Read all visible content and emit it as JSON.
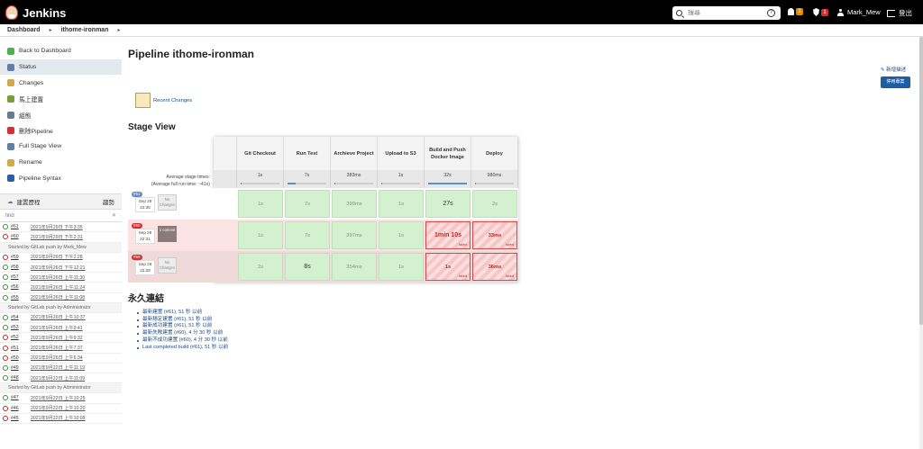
{
  "header": {
    "logo_text": "Jenkins",
    "search_placeholder": "搜尋",
    "notifications_count": "1",
    "security_count": "1",
    "user": "Mark_Mew",
    "logout": "登出"
  },
  "breadcrumb": [
    "Dashboard",
    "ithome-ironman"
  ],
  "sidebar": {
    "tasks": [
      {
        "label": "Back to Dashboard",
        "icon": "up-arrow-icon",
        "color": "#4caf50"
      },
      {
        "label": "Status",
        "icon": "search-icon",
        "color": "#5f7fa3",
        "active": true
      },
      {
        "label": "Changes",
        "icon": "notepad-icon",
        "color": "#d4a84f"
      },
      {
        "label": "馬上建置",
        "icon": "clock-icon",
        "color": "#7c9c3b"
      },
      {
        "label": "組態",
        "icon": "gear-icon",
        "color": "#6b7a8f"
      },
      {
        "label": "刪除Pipeline",
        "icon": "no-entry-icon",
        "color": "#d32f2f"
      },
      {
        "label": "Full Stage View",
        "icon": "magnifier-icon",
        "color": "#5f7fa3"
      },
      {
        "label": "Rename",
        "icon": "notepad-icon",
        "color": "#d4a84f"
      },
      {
        "label": "Pipeline Syntax",
        "icon": "help-icon",
        "color": "#2c5ea8"
      }
    ],
    "build_history": {
      "title": "建置歷程",
      "trend": "趨勢",
      "filter_placeholder": "find",
      "builds": [
        {
          "status": "ok",
          "num": "#61",
          "date": "2021年9月29日 下午3:35"
        },
        {
          "status": "fail",
          "num": "#60",
          "date": "2021年9月29日 下午2:31"
        },
        {
          "note": "Started by GitLab push by Mark_Mew"
        },
        {
          "status": "fail",
          "num": "#59",
          "date": "2021年9月29日 下午2:28"
        },
        {
          "status": "ok",
          "num": "#58",
          "date": "2021年9月26日 下午12:21"
        },
        {
          "status": "ok",
          "num": "#57",
          "date": "2021年9月26日 上午11:30"
        },
        {
          "status": "ok",
          "num": "#56",
          "date": "2021年9月26日 上午11:24"
        },
        {
          "status": "ok",
          "num": "#55",
          "date": "2021年9月26日 上午11:08"
        },
        {
          "note": "Started by GitLab push by Administrator"
        },
        {
          "status": "ok",
          "num": "#54",
          "date": "2021年9月26日 上午10:37"
        },
        {
          "status": "ok",
          "num": "#53",
          "date": "2021年9月26日 上午9:41"
        },
        {
          "status": "fail",
          "num": "#52",
          "date": "2021年9月26日 上午9:32"
        },
        {
          "status": "fail",
          "num": "#51",
          "date": "2021年9月26日 上午7:37"
        },
        {
          "status": "fail",
          "num": "#50",
          "date": "2021年9月26日 上午6:34"
        },
        {
          "status": "ok",
          "num": "#49",
          "date": "2021年9月22日 上午11:19"
        },
        {
          "status": "ok",
          "num": "#48",
          "date": "2021年9月22日 上午11:09"
        },
        {
          "note": "Started by GitLab push by Administrator"
        },
        {
          "status": "ok",
          "num": "#47",
          "date": "2021年9月22日 上午10:25"
        },
        {
          "status": "fail",
          "num": "#46",
          "date": "2021年9月22日 上午10:20"
        },
        {
          "status": "fail",
          "num": "#45",
          "date": "2021年9月22日 上午10:09"
        }
      ]
    }
  },
  "main": {
    "title": "Pipeline ithome-ironman",
    "edit_description": "新增描述",
    "disable_button": "停用專案",
    "recent_changes": "Recent Changes",
    "stage_view_title": "Stage View",
    "avg_label_1": "Average stage times:",
    "avg_label_2": "(Average full run time: ~41s)",
    "stages": [
      {
        "name": "Git Checkout",
        "avg": "1s",
        "fill": 0.03
      },
      {
        "name": "Run Test",
        "avg": "7s",
        "fill": 0.22
      },
      {
        "name": "Archieve Project",
        "avg": "383ms",
        "fill": 0.01
      },
      {
        "name": "Upload to S3",
        "avg": "1s",
        "fill": 0.03
      },
      {
        "name": "Build and Push Docker Image",
        "avg": "32s",
        "fill": 1.0
      },
      {
        "name": "Deploy",
        "avg": "980ms",
        "fill": 0.03
      }
    ],
    "runs": [
      {
        "num": "#61",
        "num_color": "#5b8fc9",
        "date": "Sep 29",
        "time": "22:35",
        "changes": "No Changes",
        "row_bg": "#fff",
        "cells": [
          {
            "t": "1s",
            "s": "succ"
          },
          {
            "t": "7s",
            "s": "succ"
          },
          {
            "t": "399ms",
            "s": "succ"
          },
          {
            "t": "1s",
            "s": "succ"
          },
          {
            "t": "27s",
            "s": "succ",
            "big": true
          },
          {
            "t": "2s",
            "s": "succ"
          }
        ]
      },
      {
        "num": "#60",
        "num_color": "#d32f2f",
        "date": "Sep 29",
        "time": "22:31",
        "changes": "1 commit",
        "row_bg": "#fbe3e3",
        "cells": [
          {
            "t": "1s",
            "s": "succ"
          },
          {
            "t": "7s",
            "s": "succ"
          },
          {
            "t": "397ms",
            "s": "succ"
          },
          {
            "t": "1s",
            "s": "succ"
          },
          {
            "t": "1min 10s",
            "s": "fail",
            "big": true
          },
          {
            "t": "33ms",
            "s": "fail"
          }
        ]
      },
      {
        "num": "#59",
        "num_color": "#d32f2f",
        "date": "Sep 29",
        "time": "22:28",
        "changes": "No Changes",
        "row_bg": "#f0d9d9",
        "cells": [
          {
            "t": "2s",
            "s": "succ"
          },
          {
            "t": "8s",
            "s": "succ",
            "big": true
          },
          {
            "t": "354ms",
            "s": "succ"
          },
          {
            "t": "1s",
            "s": "succ"
          },
          {
            "t": "1s",
            "s": "fail"
          },
          {
            "t": "36ms",
            "s": "fail"
          }
        ]
      }
    ],
    "failed_label": "failed",
    "permalinks_title": "永久連結",
    "permalinks": [
      "最新建置 (#61), 51 秒 以前",
      "最新穩定建置 (#61), 51 秒 以前",
      "最新成功建置 (#61), 51 秒 以前",
      "最新失敗建置 (#60), 4 分 30 秒 以前",
      "最新不成功建置 (#60), 4 分 30 秒 以前",
      "Last completed build (#61), 51 秒 以前"
    ]
  }
}
